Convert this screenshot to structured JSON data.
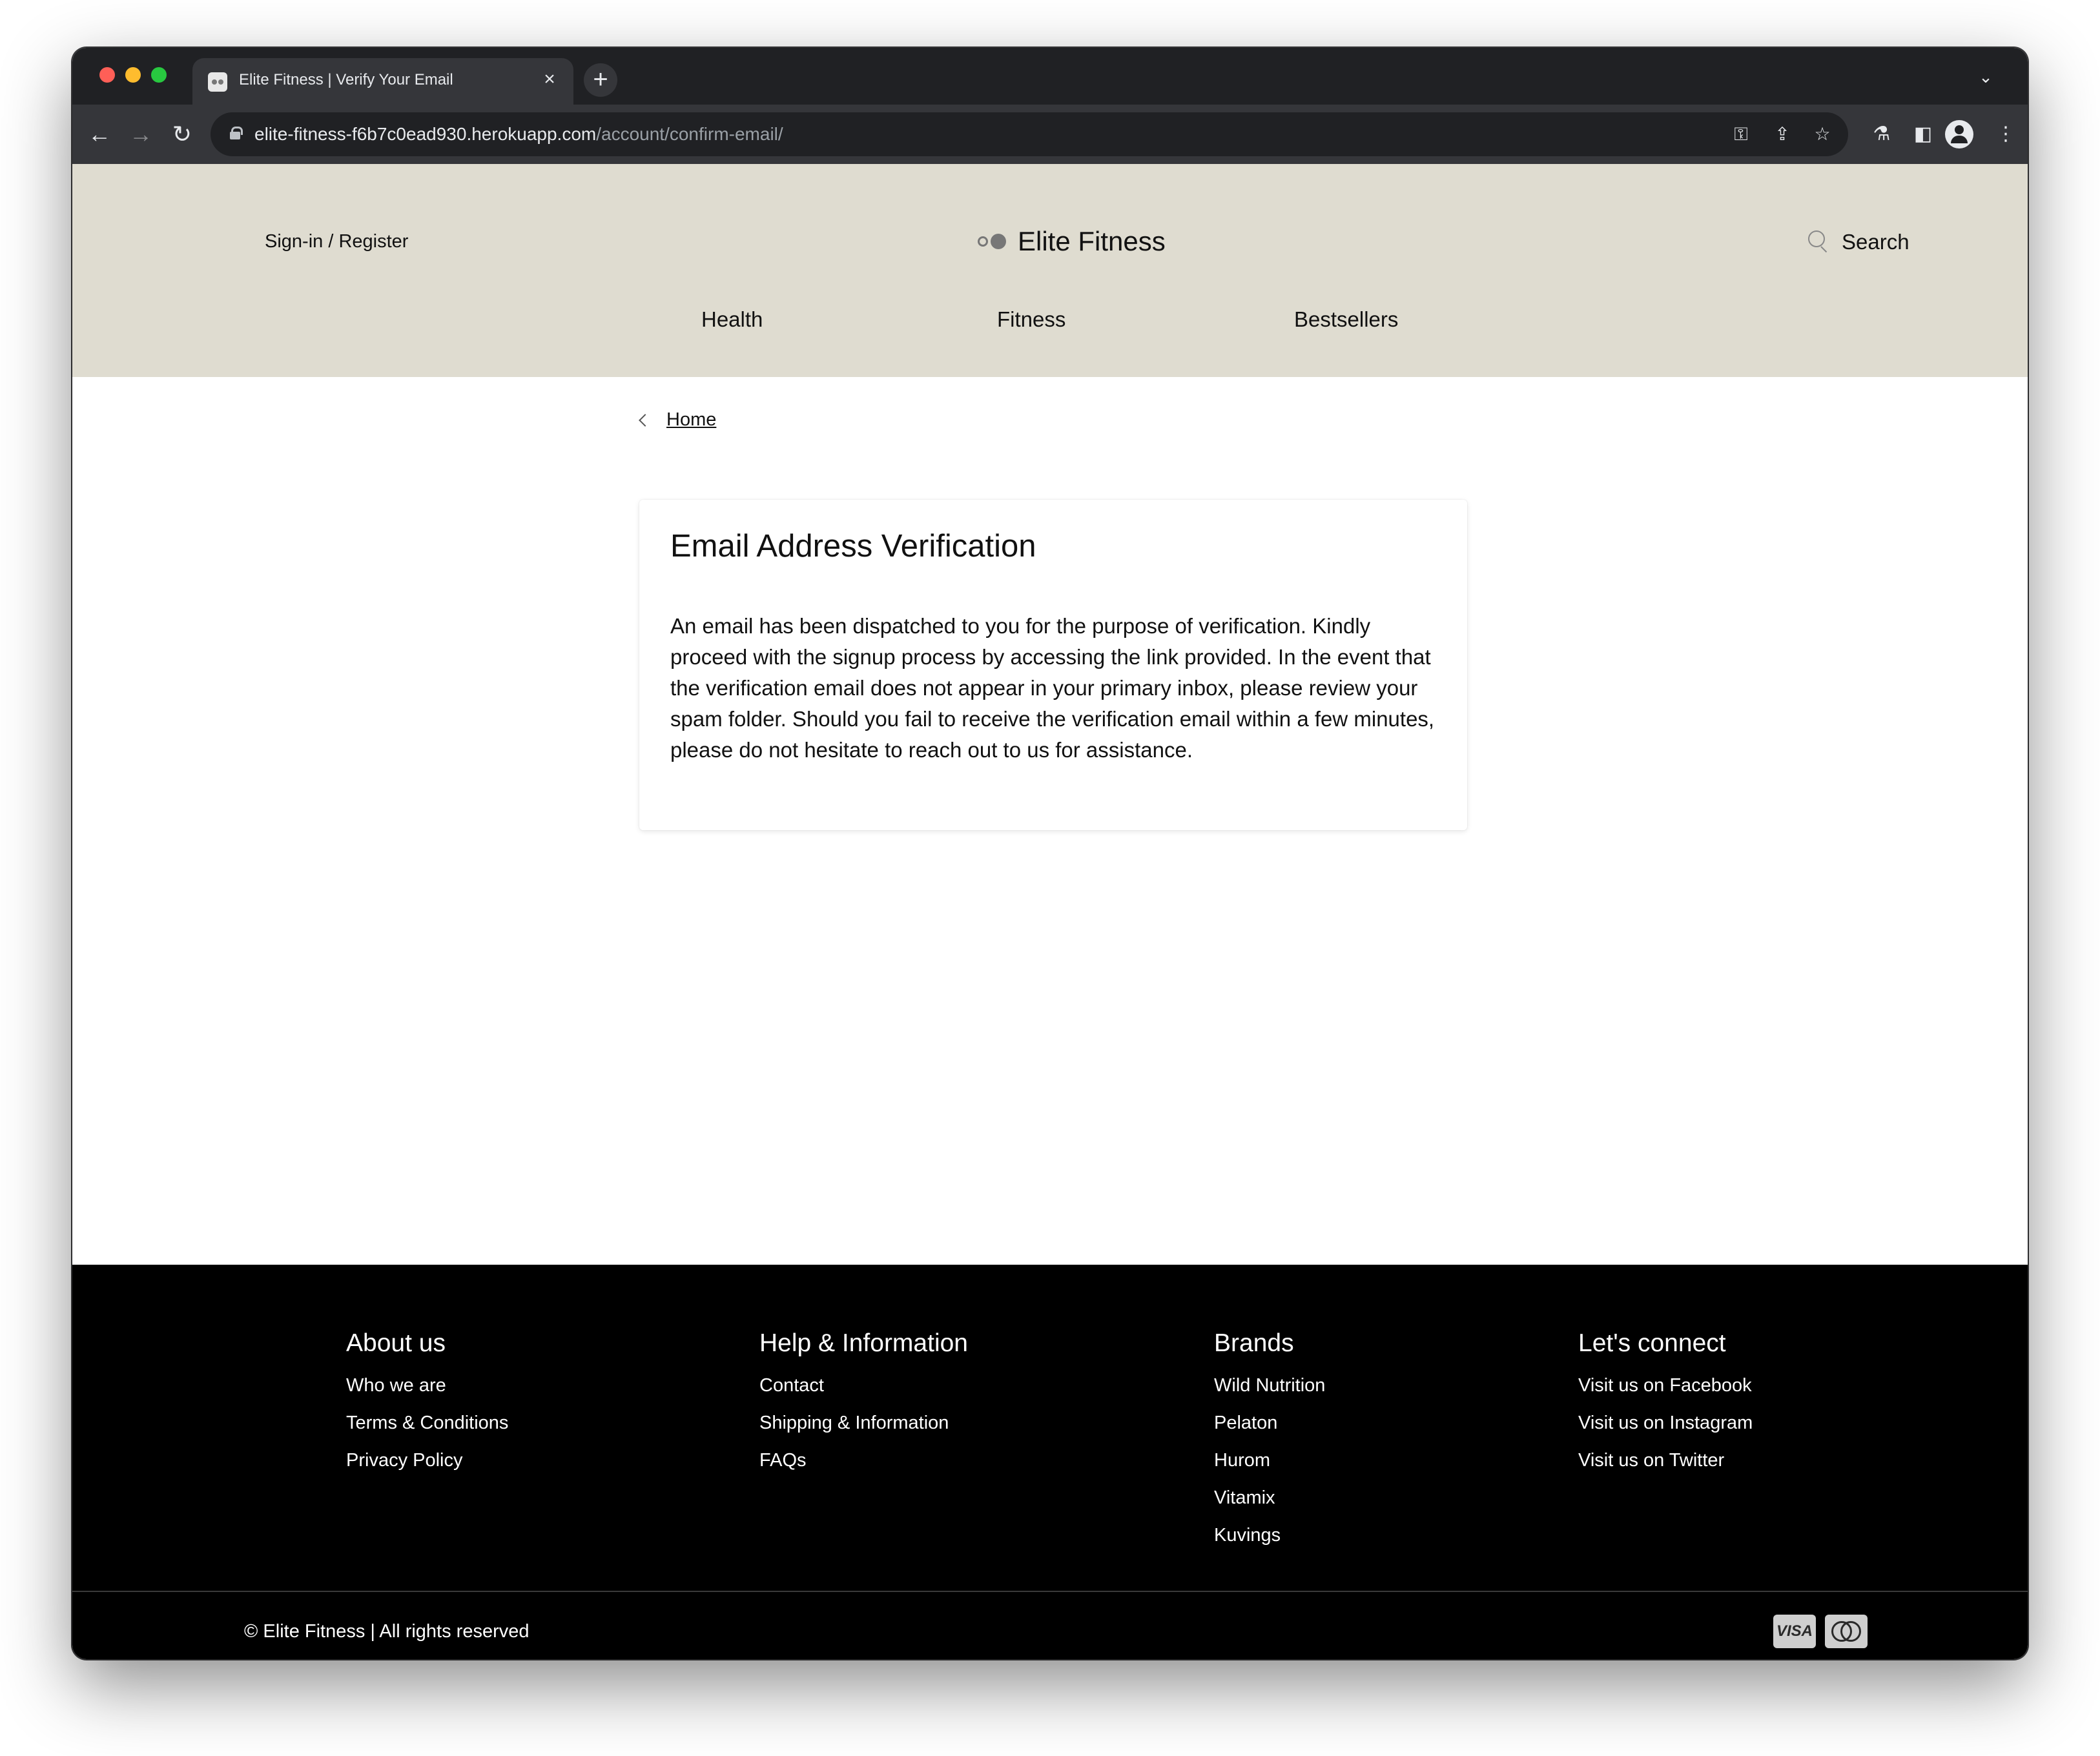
{
  "browser": {
    "tab_title": "Elite Fitness | Verify Your Email",
    "tab_close": "×",
    "new_tab": "+",
    "url_host": "elite-fitness-f6b7c0ead930.herokuapp.com",
    "url_path": "/account/confirm-email/",
    "icons": [
      "back-arrow-icon",
      "forward-arrow-icon",
      "reload-icon",
      "lock-icon",
      "key-icon",
      "share-icon",
      "star-icon",
      "labs-icon",
      "side-panel-icon",
      "profile-icon",
      "more-menu-icon"
    ]
  },
  "header": {
    "signin": "Sign-in / Register",
    "logo_text": "Elite Fitness",
    "search_label": "Search",
    "nav": [
      "Health",
      "Fitness",
      "Bestsellers"
    ],
    "background": "#dfdcd0"
  },
  "main": {
    "breadcrumb": "Home",
    "card_title": "Email Address Verification",
    "card_body": "An email has been dispatched to you for the purpose of verification. Kindly proceed with the signup process by accessing the link provided. In the event that the verification email does not appear in your primary inbox, please review your spam folder. Should you fail to receive the verification email within a few minutes, please do not hesitate to reach out to us for assistance."
  },
  "footer": {
    "columns": [
      {
        "title": "About us",
        "links": [
          "Who we are",
          "Terms & Conditions",
          "Privacy Policy"
        ]
      },
      {
        "title": "Help & Information",
        "links": [
          "Contact",
          "Shipping & Information",
          "FAQs"
        ]
      },
      {
        "title": "Brands",
        "links": [
          "Wild Nutrition",
          "Pelaton",
          "Hurom",
          "Vitamix",
          "Kuvings"
        ]
      },
      {
        "title": "Let's connect",
        "links": [
          "Visit us on Facebook",
          "Visit us on Instagram",
          "Visit us on Twitter"
        ]
      }
    ],
    "copyright": "© Elite Fitness | All rights reserved",
    "payment": [
      "VISA",
      "mastercard"
    ]
  }
}
